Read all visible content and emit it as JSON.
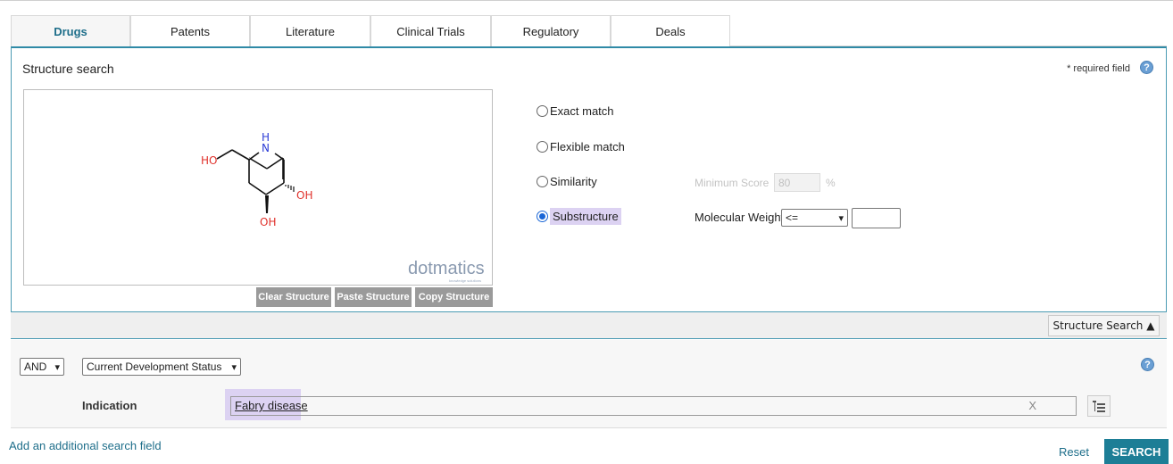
{
  "tabs": [
    {
      "label": "Drugs",
      "active": true
    },
    {
      "label": "Patents"
    },
    {
      "label": "Literature"
    },
    {
      "label": "Clinical Trials"
    },
    {
      "label": "Regulatory"
    },
    {
      "label": "Deals"
    }
  ],
  "structure": {
    "title": "Structure search",
    "required_note": "* required field",
    "help_icon": "question-icon",
    "molecule_labels": {
      "nh": "H\nN",
      "n": "N",
      "h": "H",
      "ho": "HO",
      "oh_right": "OH",
      "oh_bottom": "OH"
    },
    "brand": "dotmatics",
    "brand_tagline": "knowledge solutions",
    "buttons": {
      "clear": "Clear Structure",
      "paste": "Paste Structure",
      "copy": "Copy Structure"
    },
    "options": {
      "exact": "Exact match",
      "flexible": "Flexible match",
      "similarity": "Similarity",
      "substructure": "Substructure",
      "selected": "Substructure"
    },
    "min_score_label": "Minimum Score",
    "min_score_value": "80",
    "percent": "%",
    "mw_label": "Molecular Weight",
    "mw_operator": "<=",
    "mw_value": "",
    "toggle_label": "Structure Search ▲"
  },
  "query": {
    "operator": "AND",
    "field": "Current Development Status",
    "indication_label": "Indication",
    "indication_value": "Fabry disease",
    "clear_x": "X"
  },
  "footer": {
    "add_field": "Add an additional search field",
    "reset": "Reset",
    "search": "SEARCH"
  },
  "colors": {
    "accent": "#1d7e96",
    "panel_border": "#4b9bb3",
    "highlight": "#dcd2f2",
    "oxygen": "#e0312b",
    "nitrogen": "#2b3bd6"
  }
}
